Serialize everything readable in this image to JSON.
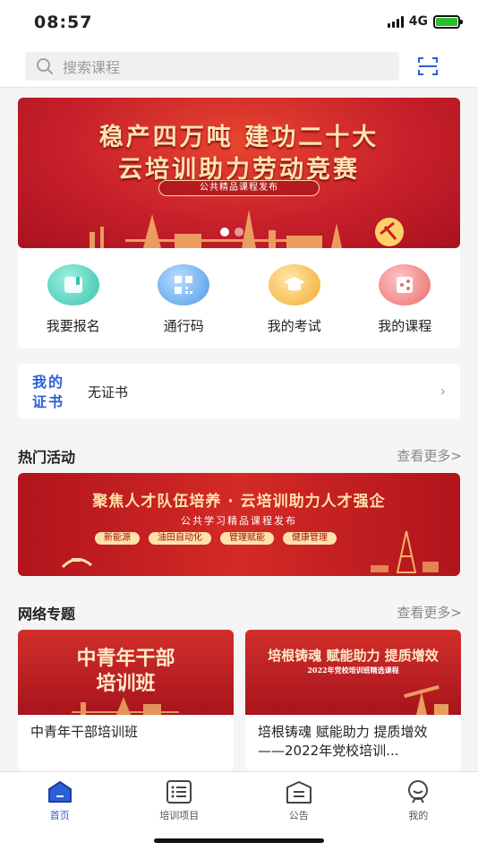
{
  "status_bar": {
    "time": "08:57",
    "network": "4G"
  },
  "search": {
    "placeholder": "搜索课程",
    "scan_icon": "scan-icon"
  },
  "banner": {
    "line1": "稳产四万吨  建功二十大",
    "line2": "云培训助力劳动竞赛",
    "pill": "公共精品课程发布",
    "slides": 2,
    "active_slide": 0
  },
  "quick_actions": [
    {
      "label": "我要报名",
      "icon": "signup-icon",
      "color": "#5fd3c3"
    },
    {
      "label": "通行码",
      "icon": "qrcode-icon",
      "color": "#6fb3f2"
    },
    {
      "label": "我的考试",
      "icon": "exam-cap-icon",
      "color": "#f6c35a"
    },
    {
      "label": "我的课程",
      "icon": "course-share-icon",
      "color": "#f48a8a"
    }
  ],
  "certificate": {
    "title": "我的证书",
    "value": "无证书"
  },
  "hot_activities": {
    "title": "热门活动",
    "more": "查看更多>",
    "banner_title": "聚焦人才队伍培养 · 云培训助力人才强企",
    "banner_sub": "公共学习精品课程发布",
    "tags": [
      "新能源",
      "油田自动化",
      "管理赋能",
      "健康管理"
    ]
  },
  "network_topics": {
    "title": "网络专题",
    "more": "查看更多>",
    "cards": [
      {
        "img_line1": "中青年干部",
        "img_line2": "培训班",
        "caption": "中青年干部培训班"
      },
      {
        "img_line1": "培根铸魂 赋能助力 提质增效",
        "img_line2": "2022年党校培训班精选课程",
        "caption": "培根铸魂 赋能助力 提质增效——2022年党校培训..."
      }
    ]
  },
  "tabbar": [
    {
      "label": "首页",
      "icon": "home-icon",
      "active": true
    },
    {
      "label": "培训项目",
      "icon": "list-icon",
      "active": false
    },
    {
      "label": "公告",
      "icon": "notice-icon",
      "active": false
    },
    {
      "label": "我的",
      "icon": "profile-icon",
      "active": false
    }
  ],
  "colors": {
    "accent": "#2b5fd8",
    "banner_red": "#c8202a"
  }
}
